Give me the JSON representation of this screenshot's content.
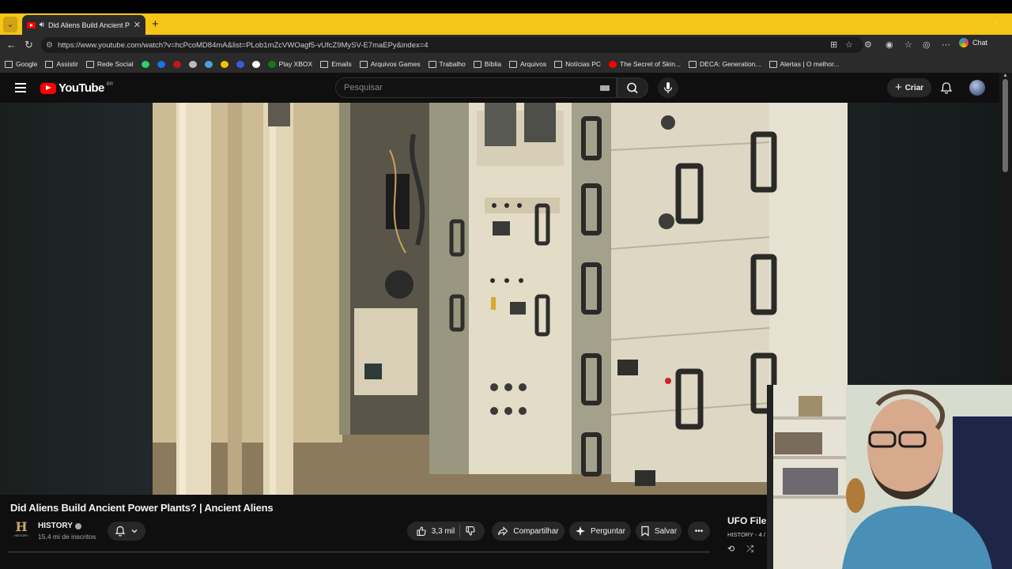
{
  "browser": {
    "tab_title": "Did Aliens Build Ancient Power Plants?",
    "url": "https://www.youtube.com/watch?v=hcPcoMD84mA&list=PLob1mZcVWOagf5-vUfcZ9MySV-E7maEPy&index=4",
    "chat_label": "Chat",
    "bookmarks": [
      {
        "label": "Google",
        "icon": "folder-icon"
      },
      {
        "label": "Assistir",
        "icon": "folder-icon"
      },
      {
        "label": "Rede Social",
        "icon": "folder-icon"
      },
      {
        "label": "",
        "icon": "whatsapp-icon",
        "color": "#25d366"
      },
      {
        "label": "",
        "icon": "globe-blue-icon",
        "color": "#1a73e8"
      },
      {
        "label": "",
        "icon": "red-site-icon",
        "color": "#c4161c"
      },
      {
        "label": "",
        "icon": "grey-site-icon",
        "color": "#bbbbbb"
      },
      {
        "label": "",
        "icon": "star-site-icon",
        "color": "#4aa3df"
      },
      {
        "label": "",
        "icon": "yellow-site-icon",
        "color": "#f2c200"
      },
      {
        "label": "",
        "icon": "blue-site-icon",
        "color": "#3b5bdb"
      },
      {
        "label": "",
        "icon": "s-site-icon",
        "color": "#ffffff"
      },
      {
        "label": "Play XBOX",
        "icon": "xbox-icon",
        "color": "#107c10"
      },
      {
        "label": "Emails",
        "icon": "folder-icon"
      },
      {
        "label": "Arquivos Games",
        "icon": "folder-icon"
      },
      {
        "label": "Trabalho",
        "icon": "folder-icon"
      },
      {
        "label": "Bíblia",
        "icon": "folder-icon"
      },
      {
        "label": "Arquivos",
        "icon": "folder-icon"
      },
      {
        "label": "Notícias PC",
        "icon": "folder-icon"
      },
      {
        "label": "The Secret of Skin...",
        "icon": "youtube-icon",
        "color": "#ff0000"
      },
      {
        "label": "DECA: Generation...",
        "icon": "globe-icon"
      },
      {
        "label": "Alertas | O melhor...",
        "icon": "diamond-icon"
      }
    ]
  },
  "youtube": {
    "country_code": "BR",
    "search_placeholder": "Pesquisar",
    "create_label": "Criar",
    "video": {
      "title": "Did Aliens Build Ancient Power Plants? | Ancient Aliens",
      "channel": "HISTORY",
      "subscribers": "15,4 mi de inscritos",
      "likes": "3,3 mil",
      "share_label": "Compartilhar",
      "ask_label": "Perguntar",
      "save_label": "Salvar"
    },
    "playlist": {
      "title": "UFO File",
      "subtitle": "HISTORY - 4 /"
    }
  },
  "colors": {
    "brand_red": "#ff0000",
    "tabstrip": "#f5c518",
    "background": "#0f0f0f"
  }
}
